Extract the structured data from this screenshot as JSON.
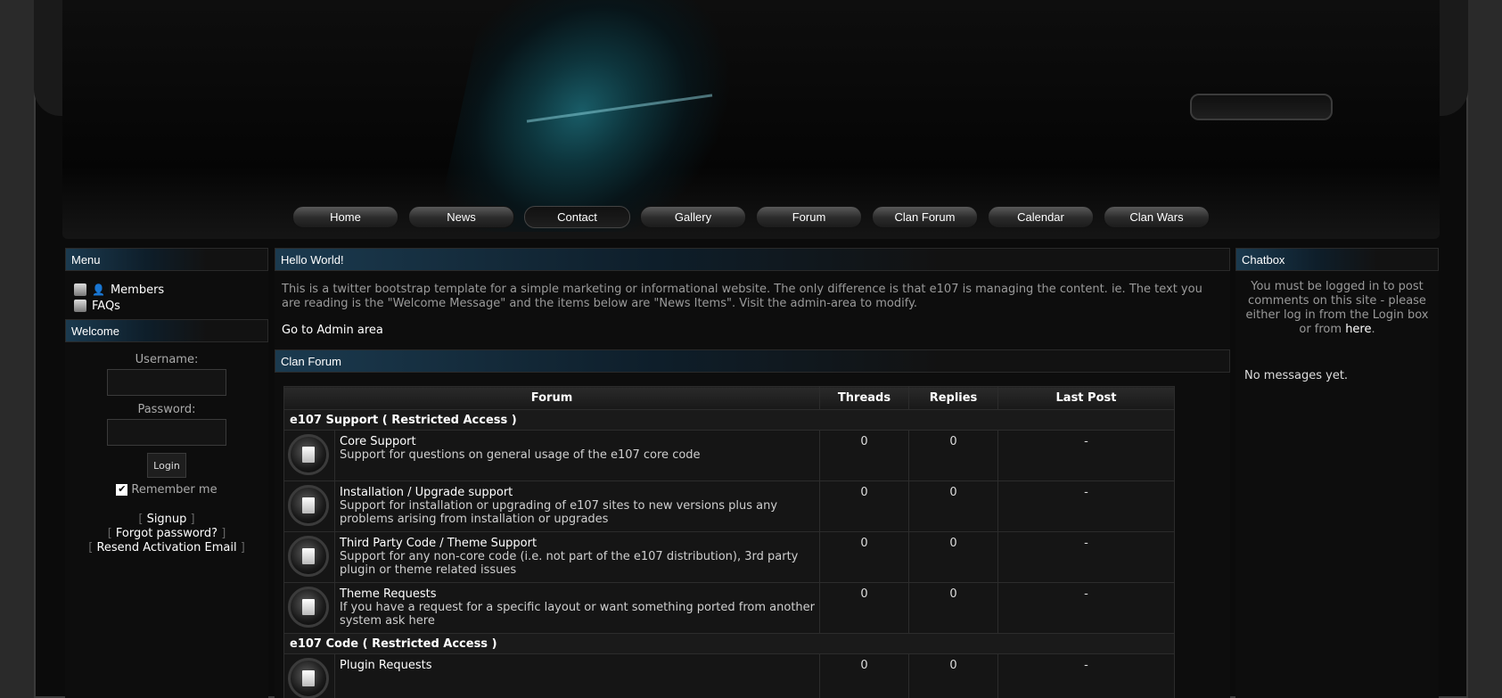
{
  "nav": [
    "Home",
    "News",
    "Contact",
    "Gallery",
    "Forum",
    "Clan Forum",
    "Calendar",
    "Clan Wars"
  ],
  "nav_active": "Contact",
  "left": {
    "menu_title": "Menu",
    "menu_items": [
      "Members",
      "FAQs"
    ],
    "welcome_title": "Welcome",
    "username_label": "Username:",
    "password_label": "Password:",
    "login_button": "Login",
    "remember_label": "Remember me",
    "signup": "Signup",
    "forgot": "Forgot password?",
    "resend": "Resend Activation Email"
  },
  "main": {
    "hello_title": "Hello World!",
    "welcome_text": "This is a twitter bootstrap template for a simple marketing or informational website. The only difference is that e107 is managing the content. ie. The text you are reading is the \"Welcome Message\" and the items below are \"News Items\". Visit the admin-area to modify.",
    "admin_link": "Go to Admin area",
    "clan_forum_title": "Clan Forum",
    "table_headers": [
      "Forum",
      "Threads",
      "Replies",
      "Last Post"
    ],
    "categories": [
      {
        "name": "e107 Support ( Restricted Access )",
        "forums": [
          {
            "title": "Core Support",
            "desc": "Support for questions on general usage of the e107 core code",
            "threads": "0",
            "replies": "0",
            "last": "-"
          },
          {
            "title": "Installation / Upgrade support",
            "desc": "Support for installation or upgrading of e107 sites to new versions plus any problems arising from installation or upgrades",
            "threads": "0",
            "replies": "0",
            "last": "-"
          },
          {
            "title": "Third Party Code / Theme Support",
            "desc": "Support for any non-core code (i.e. not part of the e107 distribution), 3rd party plugin or theme related issues",
            "threads": "0",
            "replies": "0",
            "last": "-"
          },
          {
            "title": "Theme Requests",
            "desc": "If you have a request for a specific layout or want something ported from another system ask here",
            "threads": "0",
            "replies": "0",
            "last": "-"
          }
        ]
      },
      {
        "name": "e107 Code ( Restricted Access )",
        "forums": [
          {
            "title": "Plugin Requests",
            "desc": "",
            "threads": "0",
            "replies": "0",
            "last": "-"
          }
        ]
      }
    ]
  },
  "right": {
    "chatbox_title": "Chatbox",
    "msg_pre": "You must be logged in to post comments on this site - please either log in from the Login box or from ",
    "msg_link": "here",
    "msg_post": ".",
    "empty": "No messages yet."
  }
}
